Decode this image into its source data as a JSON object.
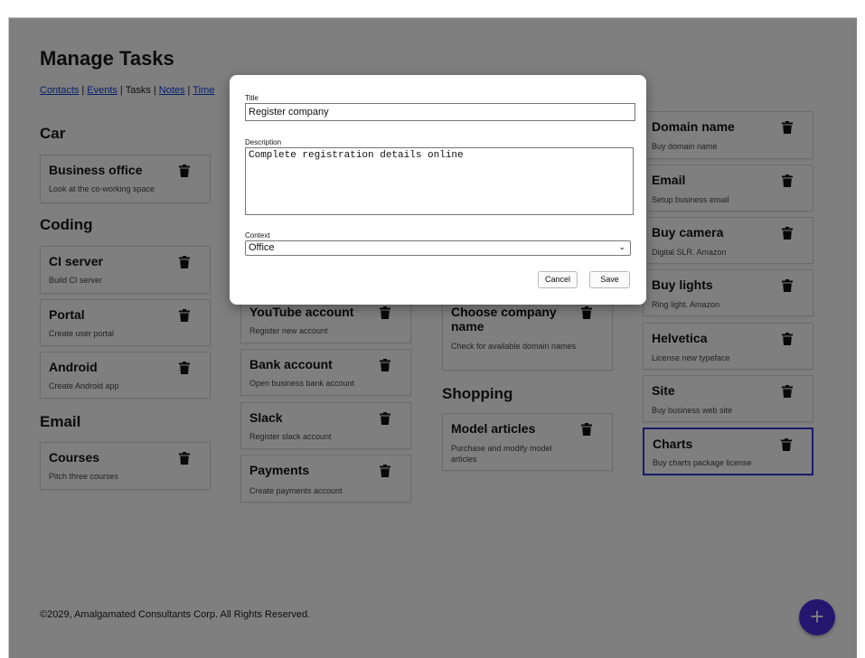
{
  "page": {
    "title": "Manage Tasks",
    "nav": {
      "contacts": "Contacts",
      "events": "Events",
      "tasks": "Tasks",
      "notes": "Notes",
      "timeline": "Time"
    },
    "footer": "©2029, Amalgamated Consultants Corp. All Rights Reserved.",
    "fab_label": "+"
  },
  "groups": {
    "car": "Car",
    "coding": "Coding",
    "email": "Email",
    "shopping": "Shopping"
  },
  "tasks": {
    "business_office": {
      "title": "Business office",
      "desc": "Look at the co-working space"
    },
    "ci_server": {
      "title": "CI server",
      "desc": "Build CI server"
    },
    "portal": {
      "title": "Portal",
      "desc": "Create user portal"
    },
    "android": {
      "title": "Android",
      "desc": "Create Android app"
    },
    "courses": {
      "title": "Courses",
      "desc": "Pitch three courses"
    },
    "youtube": {
      "title": "YouTube account",
      "desc": "Register new account"
    },
    "bank": {
      "title": "Bank account",
      "desc": "Open business bank account"
    },
    "slack": {
      "title": "Slack",
      "desc": "Register slack account"
    },
    "payments": {
      "title": "Payments",
      "desc": "Create payments account"
    },
    "company_name": {
      "title": "Choose company name",
      "desc": "Check for available domain names"
    },
    "model_articles": {
      "title": "Model articles",
      "desc": "Purchase and modify model articles"
    },
    "domain_name": {
      "title": "Domain name",
      "desc": "Buy domain name"
    },
    "email_setup": {
      "title": "Email",
      "desc": "Setup business email"
    },
    "buy_camera": {
      "title": "Buy camera",
      "desc": "Digital SLR. Amazon"
    },
    "buy_lights": {
      "title": "Buy lights",
      "desc": "Ring light. Amazon"
    },
    "helvetica": {
      "title": "Helvetica",
      "desc": "License new typeface"
    },
    "site": {
      "title": "Site",
      "desc": "Buy business web site"
    },
    "charts": {
      "title": "Charts",
      "desc": "Buy charts package license"
    }
  },
  "modal": {
    "title_label": "Title",
    "title_value": "Register company",
    "description_label": "Description",
    "description_value": "Complete registration details online",
    "context_label": "Context",
    "context_value": "Office",
    "cancel_label": "Cancel",
    "save_label": "Save"
  },
  "colors": {
    "overlay": "#808080",
    "link": "#0a3fd6",
    "fab": "#4b2fe0",
    "selected_border": "#2a3ad1"
  }
}
